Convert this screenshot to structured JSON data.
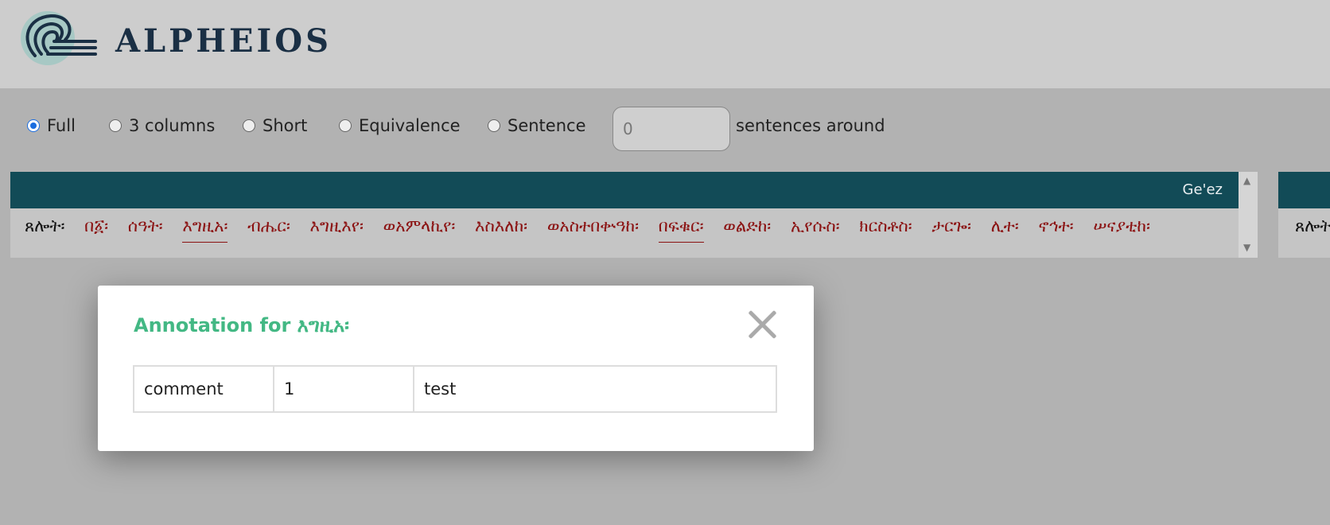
{
  "brand": {
    "name": "ALPHEIOS"
  },
  "view_options": {
    "items": [
      {
        "label": "Full",
        "checked": true
      },
      {
        "label": "3 columns",
        "checked": false
      },
      {
        "label": "Short",
        "checked": false
      },
      {
        "label": "Equivalence",
        "checked": false
      },
      {
        "label": "Sentence",
        "checked": false
      }
    ],
    "sentences_value": "0",
    "sentences_label": "sentences around"
  },
  "panel": {
    "language": "Ge'ez",
    "words": [
      "ጸሎት፡",
      "በ፩፡",
      "ሰዓት፡",
      "እግዚአ፡",
      "ብሔር፡",
      "እግዚእየ፡",
      "ወአምላኪየ፡",
      "እስእለከ፡",
      "ወአስተበቍዓከ፡",
      "በፍቁር፡",
      "ወልድከ፡",
      "ኢየሱስ፡",
      "ክርስቶስ፡",
      "ታርጐ፡",
      "ሊተ፡",
      "ኖኅተ፡",
      "ሠናያቲከ፡"
    ],
    "second_panel_word": "ጸሎት፡"
  },
  "modal": {
    "title": "Annotation for እግዚአ፡",
    "row": [
      "comment",
      "1",
      "test"
    ]
  },
  "colors": {
    "header_bg": "#cdcdcd",
    "page_bg": "#b2b2b2",
    "panel_head": "#124b57",
    "word_link": "#8b1212",
    "modal_title": "#43b884"
  }
}
